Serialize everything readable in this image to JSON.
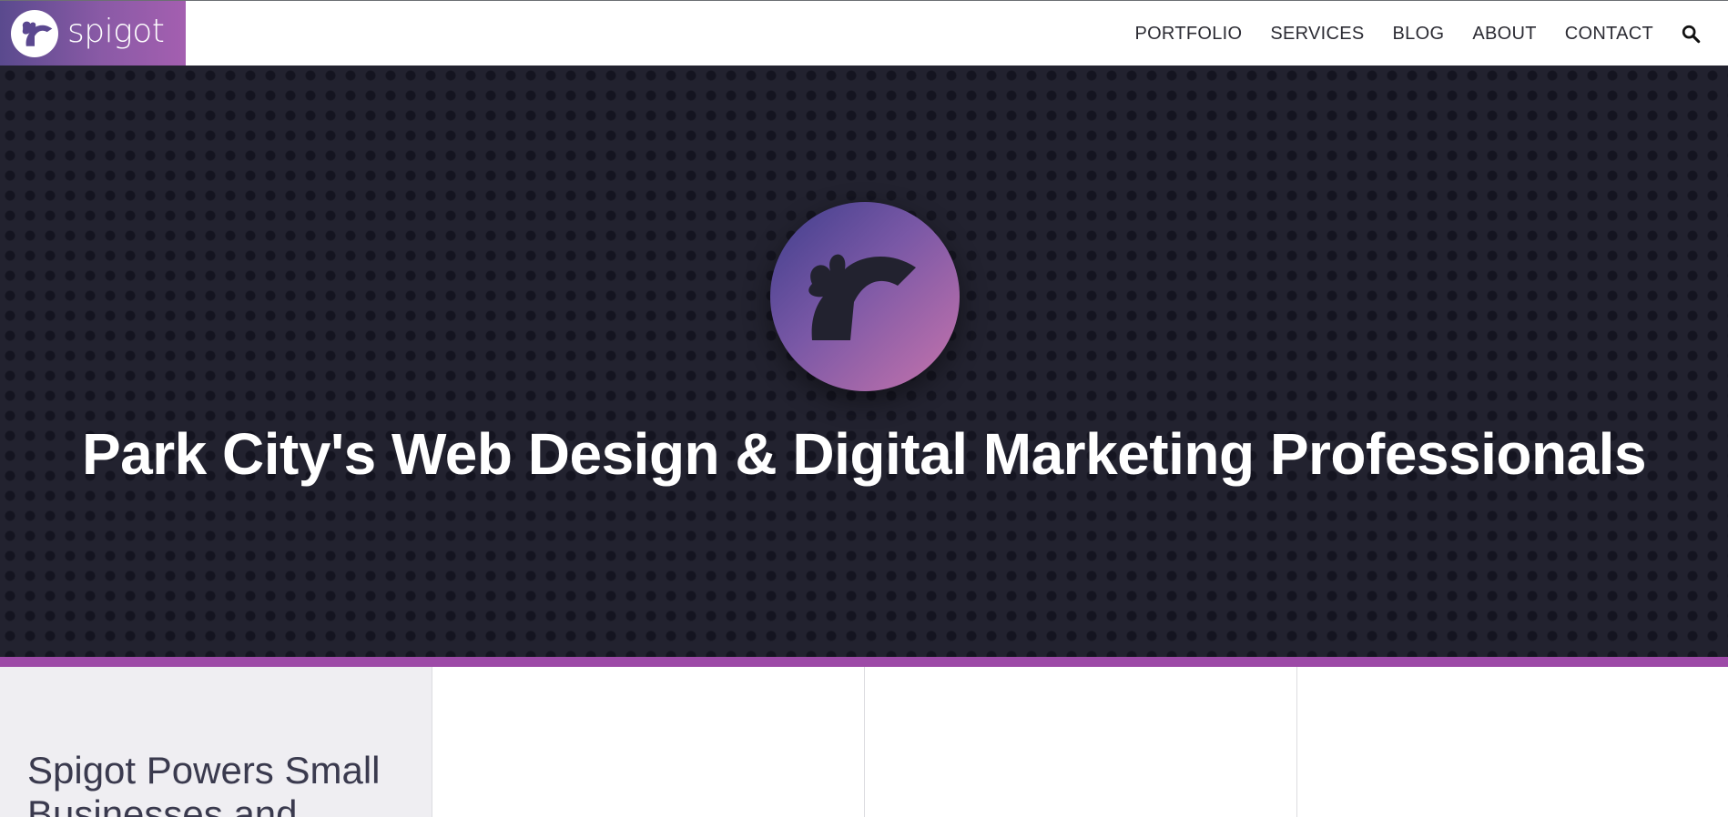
{
  "header": {
    "logo_text": "spigot",
    "nav": [
      {
        "label": "PORTFOLIO"
      },
      {
        "label": "SERVICES"
      },
      {
        "label": "BLOG"
      },
      {
        "label": "ABOUT"
      },
      {
        "label": "CONTACT"
      }
    ],
    "search_icon": "search-icon"
  },
  "hero": {
    "logo_icon": "spigot-emblem-icon",
    "title": "Park City's Web Design & Digital Marketing Professionals"
  },
  "intro": {
    "heading": "Spigot Powers Small Businesses and"
  },
  "colors": {
    "brand_purple": "#9d4aa7",
    "hero_background": "#22222f",
    "logo_gradient_start": "#3f3e8c",
    "logo_gradient_end": "#c874ac"
  }
}
